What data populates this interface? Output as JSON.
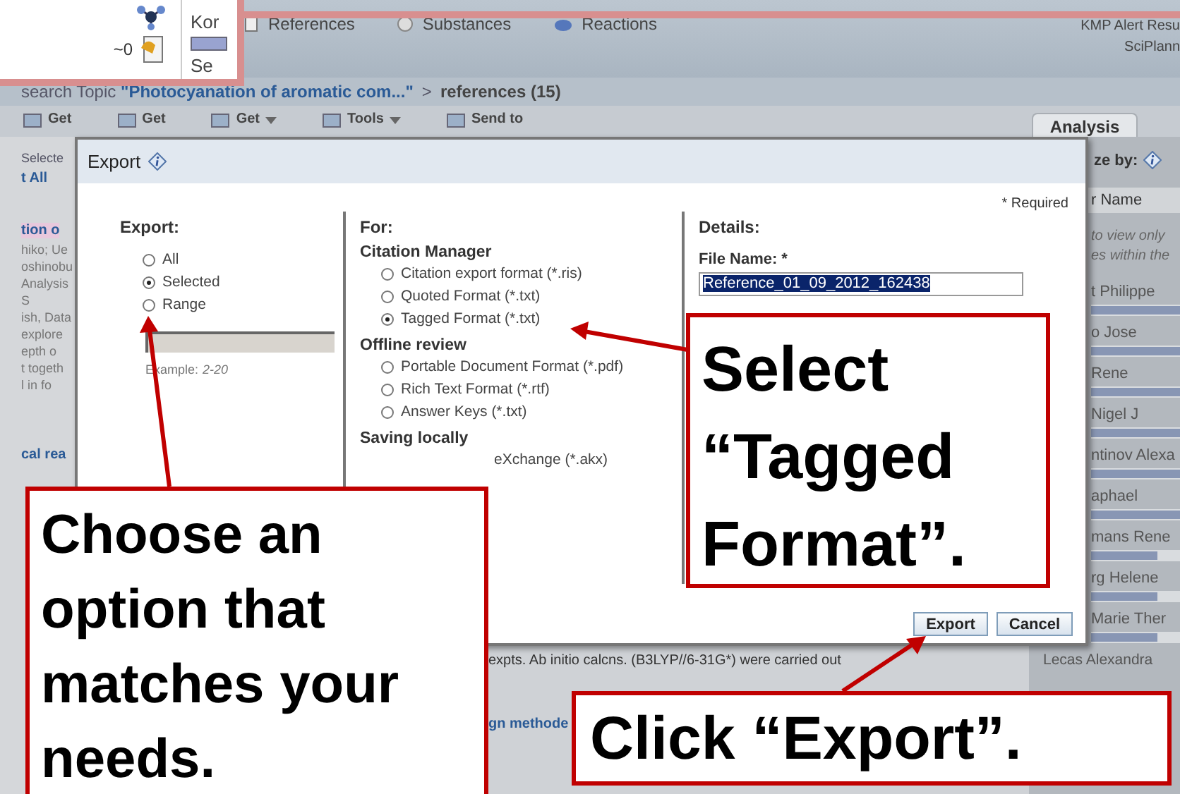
{
  "inset": {
    "count": "~0",
    "tab_fragments": [
      "Kor",
      "Se"
    ]
  },
  "nav": {
    "tabs": [
      {
        "label": "References"
      },
      {
        "label": "Substances"
      },
      {
        "label": "Reactions"
      }
    ],
    "alert": "KMP Alert Resu",
    "user": "SciPlann"
  },
  "breadcrumb": {
    "prefix": "search Topic",
    "topic": "\"Photocyanation of aromatic com...\"",
    "separator": ">",
    "current": "references (15)"
  },
  "toolbar": [
    {
      "label": "Get",
      "menu": false
    },
    {
      "label": "Get",
      "menu": false
    },
    {
      "label": "Get",
      "menu": true
    },
    {
      "label": "Tools",
      "menu": true
    },
    {
      "label": "Send to",
      "menu": false
    }
  ],
  "results": {
    "select_label": "Selecte",
    "select_all": "t All",
    "title_fragment": "tion o",
    "snippet_lines": [
      "hiko; Ue",
      "oshinobu",
      "Analysis S",
      "ish, Data",
      "explore",
      "epth o",
      "t togeth",
      "l in fo"
    ],
    "next_title": "cal rea",
    "abstract_tail": "expts.  Ab initio calcns. (B3LYP//6-31G*) were carried out",
    "link_fragment": "gn methode"
  },
  "analysis": {
    "tab": "Analysis",
    "analyze_by": "ze by:",
    "column": "r Name",
    "hint_lines": [
      "to view only",
      "es within the"
    ],
    "authors": [
      {
        "name": "t Philippe",
        "level": 1
      },
      {
        "name": "o Jose",
        "level": 1
      },
      {
        "name": "Rene",
        "level": 1
      },
      {
        "name": "Nigel J",
        "level": 1
      },
      {
        "name": "ntinov Alexa",
        "level": 1
      },
      {
        "name": "aphael",
        "level": 1
      },
      {
        "name": "mans Rene",
        "level": 0.75
      },
      {
        "name": "rg Helene",
        "level": 0.75
      },
      {
        "name": "Marie Ther",
        "level": 0.75
      },
      {
        "name": "Lecas Alexandra"
      }
    ]
  },
  "dialog": {
    "title": "Export",
    "required_note": "* Required",
    "export": {
      "heading": "Export:",
      "options": [
        {
          "label": "All",
          "selected": false
        },
        {
          "label": "Selected",
          "selected": true
        },
        {
          "label": "Range",
          "selected": false
        }
      ],
      "example_label": "Example:",
      "example_value": "2-20"
    },
    "for": {
      "heading": "For:",
      "groups": [
        {
          "title": "Citation Manager",
          "options": [
            {
              "label": "Citation export format (*.ris)",
              "selected": false
            },
            {
              "label": "Quoted Format (*.txt)",
              "selected": false
            },
            {
              "label": "Tagged Format (*.txt)",
              "selected": true
            }
          ]
        },
        {
          "title": "Offline review",
          "options": [
            {
              "label": "Portable Document Format (*.pdf)",
              "selected": false
            },
            {
              "label": "Rich Text Format (*.rtf)",
              "selected": false
            },
            {
              "label": "Answer Keys (*.txt)",
              "selected": false
            }
          ]
        },
        {
          "title": "Saving locally",
          "options": [
            {
              "label": "eXchange (*.akx)"
            }
          ]
        }
      ]
    },
    "details": {
      "heading": "Details:",
      "file_label": "File Name: *",
      "file_value": "Reference_01_09_2012_162438"
    },
    "buttons": [
      {
        "label": "Export"
      },
      {
        "label": "Cancel"
      }
    ]
  },
  "callouts": [
    {
      "text": "Select “Tagged Format”."
    },
    {
      "text": "Choose an option that matches your needs."
    },
    {
      "text": "Click “Export”."
    }
  ]
}
